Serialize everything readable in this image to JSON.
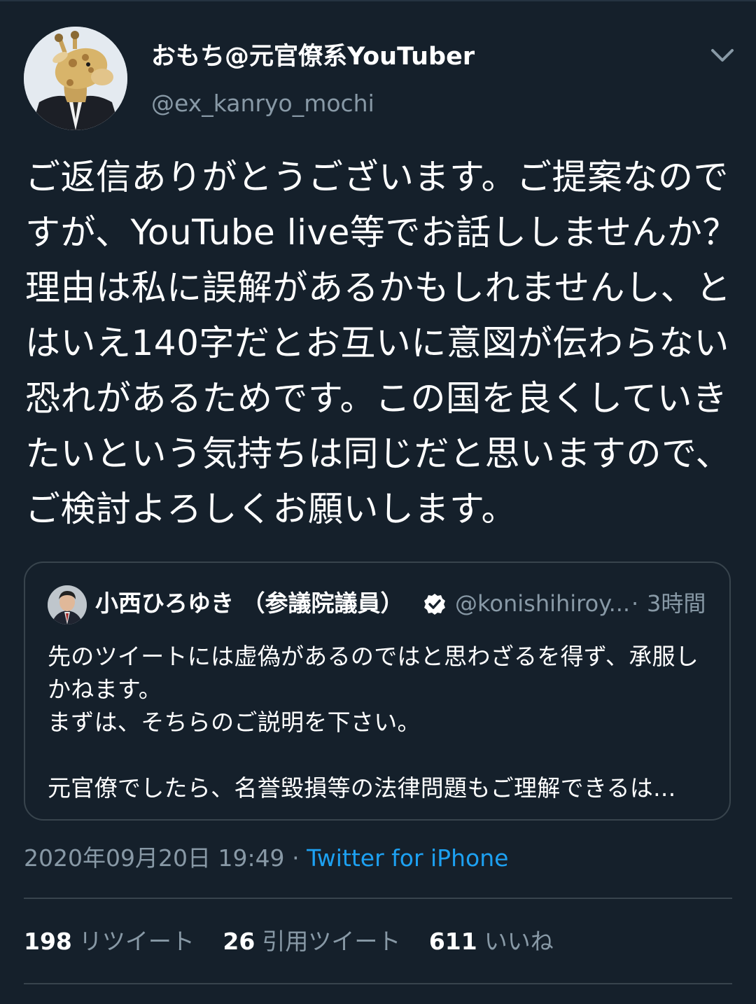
{
  "tweet": {
    "author_name": "おもち@元官僚系YouTuber",
    "author_handle": "@ex_kanryo_mochi",
    "text": "ご返信ありがとうございます。ご提案なのですが、YouTube live等でお話ししませんか？理由は私に誤解があるかもしれませんし、とはいえ140字だとお互いに意図が伝わらない恐れがあるためです。この国を良くしていきたいという気持ちは同じだと思いますので、ご検討よろしくお願いします。",
    "date": "2020年09月20日 19:49",
    "separator": "·",
    "source": "Twitter for iPhone"
  },
  "quoted_tweet": {
    "author_name": "小西ひろゆき （参議院議員）",
    "author_handle": "@konishihiroy...",
    "separator": "·",
    "time": "3時間",
    "text": "先のツイートには虚偽があるのではと思わざるを得ず、承服しかねます。\nまずは、そちらのご説明を下さい。\n\n元官僚でしたら、名誉毀損等の法律問題もご理解できるは..."
  },
  "stats": {
    "retweets": {
      "count": "198",
      "label": "リツイート"
    },
    "quotes": {
      "count": "26",
      "label": "引用ツイート"
    },
    "likes": {
      "count": "611",
      "label": "いいね"
    }
  },
  "colors": {
    "background": "#15202b",
    "secondary_text": "#8899a6",
    "link": "#1da1f2",
    "border": "#38444d"
  },
  "icons": {
    "more": "chevron-down-icon",
    "verified": "verified-badge-icon"
  }
}
